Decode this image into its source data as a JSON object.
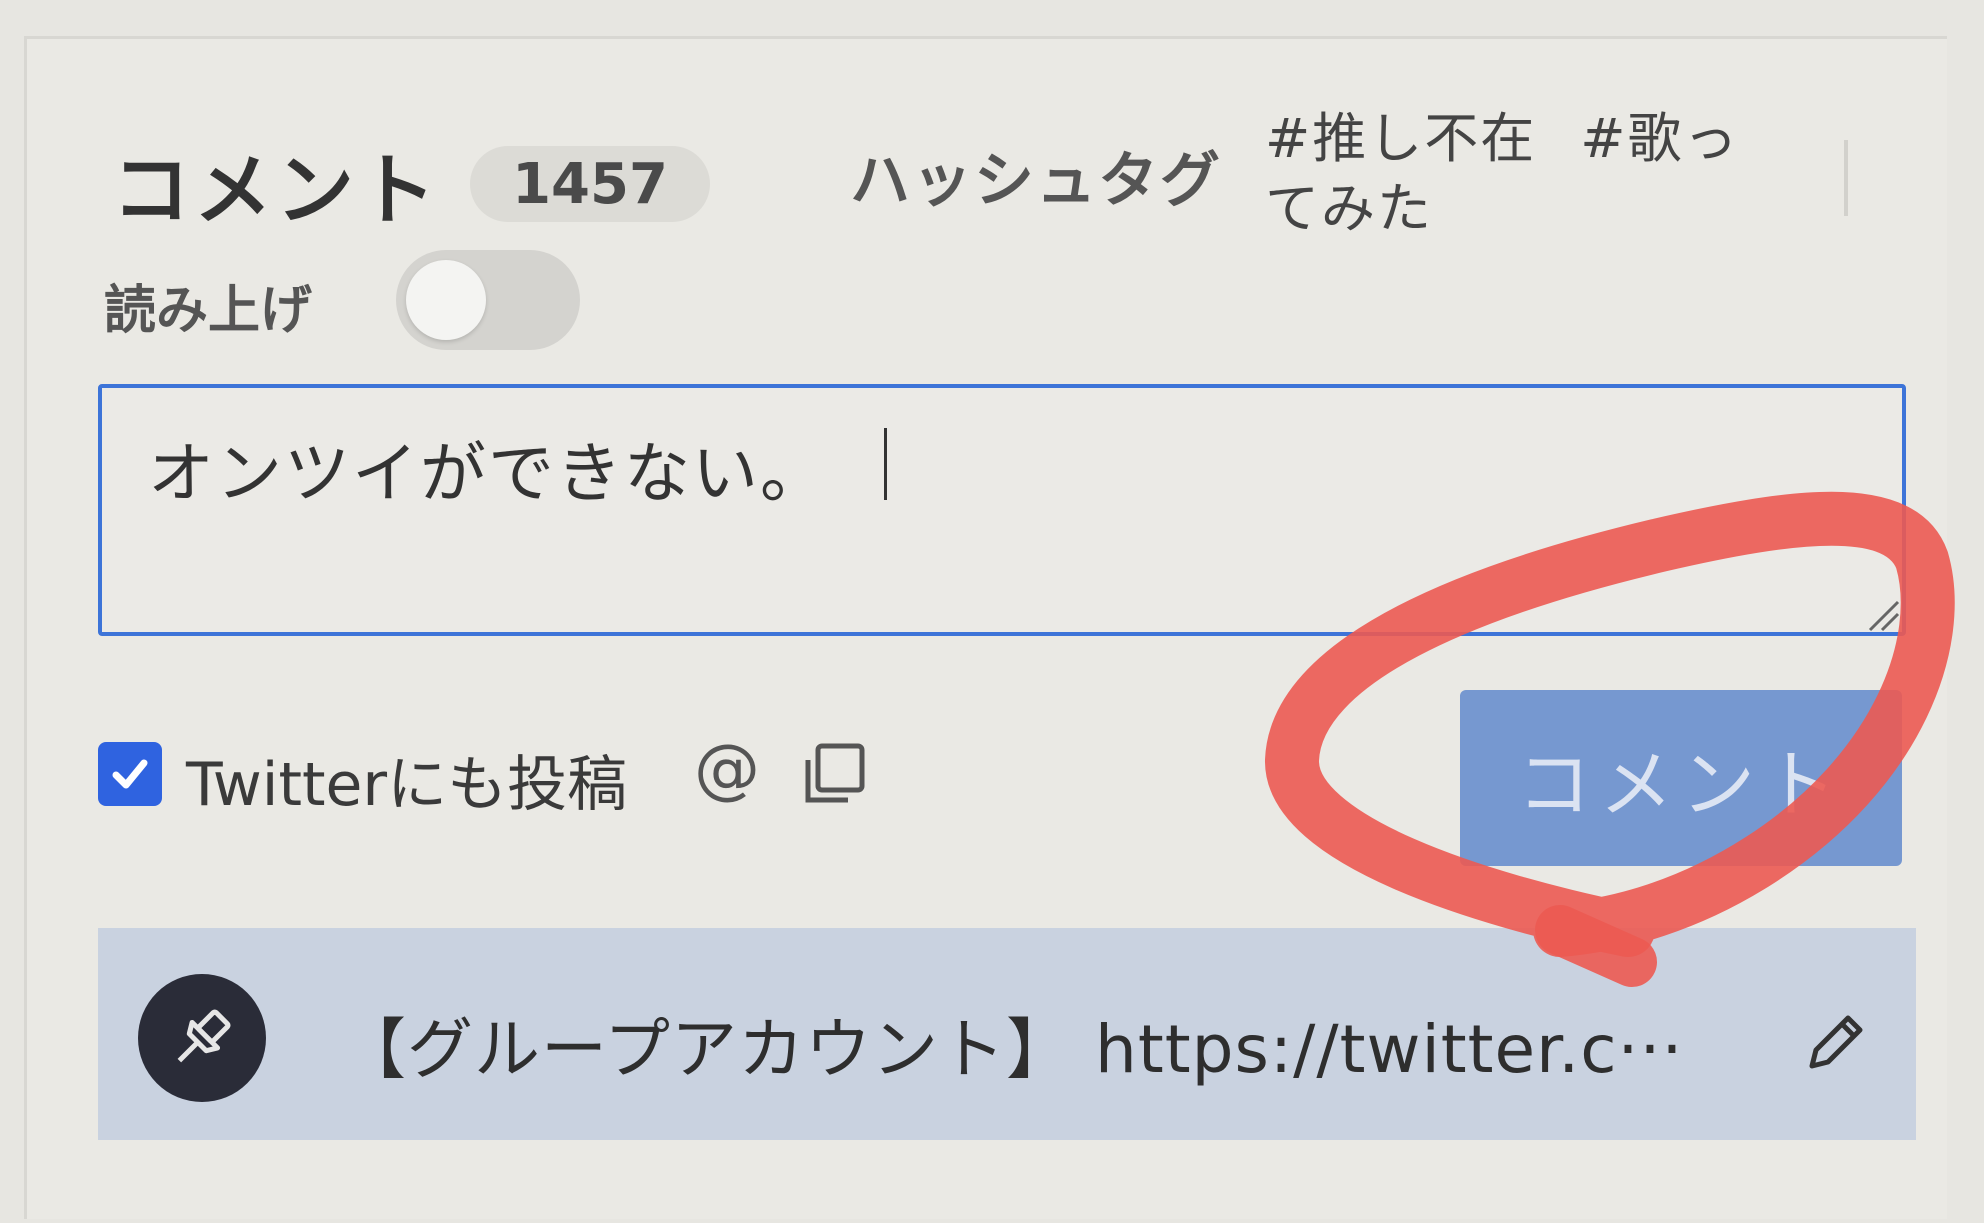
{
  "header": {
    "title": "コメント",
    "count": "1457",
    "hashtag_label": "ハッシュタグ",
    "hashtags": [
      "#推し不在",
      "#歌ってみた"
    ]
  },
  "readout": {
    "label": "読み上げ",
    "enabled": false
  },
  "comment_input": {
    "value": "オンツイができない。"
  },
  "twitter_share": {
    "checked": true,
    "label": "Twitterにも投稿"
  },
  "submit": {
    "label": "コメント"
  },
  "pinned": {
    "text": "【グループアカウント】 https://twitter.c···"
  },
  "colors": {
    "accent": "#3d74d8",
    "button": "#7698d0",
    "annotation": "#ec5a52",
    "pinned_bg": "#c9d2e0"
  },
  "icons": [
    "toggle-switch",
    "checkbox-check-icon",
    "at-icon",
    "copy-icon",
    "pin-icon",
    "pencil-icon",
    "resize-handle-icon"
  ]
}
